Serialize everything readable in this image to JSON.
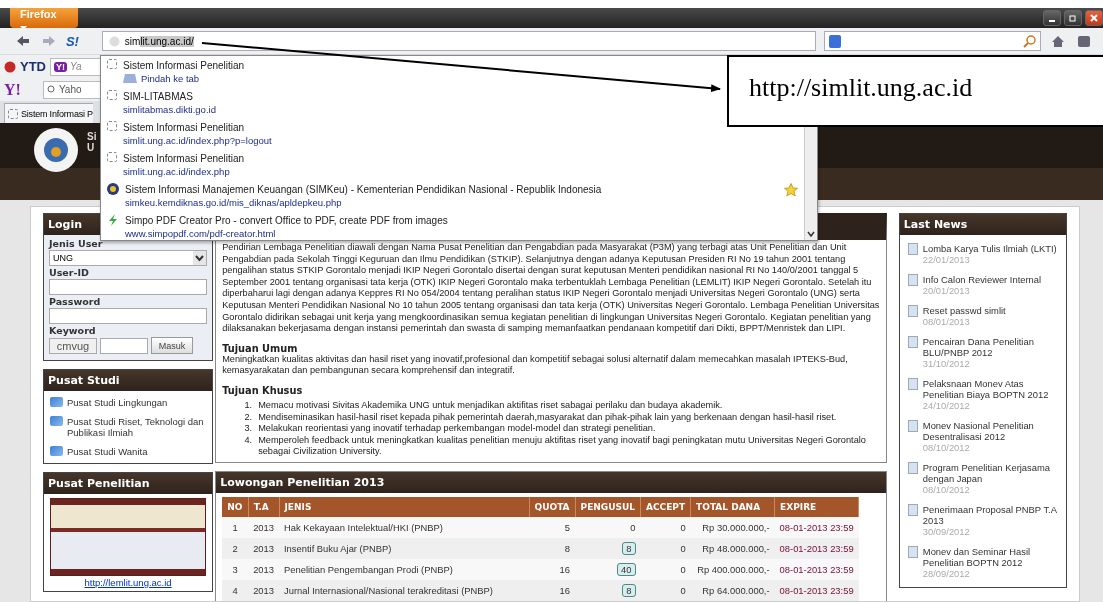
{
  "browser": {
    "menu_button": "Firefox",
    "site_logo": "S!",
    "url": {
      "typed": "sim",
      "completed": "lit.ung.ac.id/"
    }
  },
  "toolbar_ytd": {
    "brand": "YTD",
    "yahoo_badge": "Y!",
    "search_placeholder": "Ya"
  },
  "toolbar_yahoo": {
    "logo": "Y!",
    "search_placeholder": "Yaho"
  },
  "tab": {
    "title": "Sistem Informasi P"
  },
  "site_header": {
    "line_1": "Si",
    "line_2": "U"
  },
  "url_suggestions": [
    {
      "title": "Sistem Informasi Penelitian",
      "subtitle": "Pindah ke tab",
      "kind": "open-tab",
      "bookmarked": false
    },
    {
      "title": "SIM-LITABMAS",
      "subtitle": "simlitabmas.dikti.go.id",
      "kind": "page",
      "bookmarked": false
    },
    {
      "title": "Sistem Informasi Penelitian",
      "subtitle": "simlit.ung.ac.id/index.php?p=logout",
      "kind": "page",
      "bookmarked": false
    },
    {
      "title": "Sistem Informasi Penelitian",
      "subtitle": "simlit.ung.ac.id/index.php",
      "kind": "page",
      "bookmarked": false
    },
    {
      "title": "Sistem Informasi Manajemen Keuangan (SIMKeu) - Kementerian Pendidikan Nasional - Republik Indonesia",
      "subtitle": "simkeu.kemdiknas.go.id/mis_diknas/apldepkeu.php",
      "kind": "seal",
      "bookmarked": true
    },
    {
      "title": "Simpo PDF Creator Pro - convert Office to PDF, create PDF from images",
      "subtitle": "www.simpopdf.com/pdf-creator.html",
      "kind": "bolt",
      "bookmarked": false
    }
  ],
  "callout": {
    "text": "http://simlit.ung.ac.id"
  },
  "login": {
    "title": "Login",
    "user_type_label": "Jenis User",
    "user_type_value": "UNG",
    "user_id_label": "User-ID",
    "password_label": "Password",
    "keyword_label": "Keyword",
    "captcha": "cmvug",
    "submit": "Masuk"
  },
  "pusat_studi": {
    "title": "Pusat Studi",
    "items": [
      "Pusat Studi Lingkungan",
      "Pusat Studi Riset, Teknologi dan Publikasi Ilmiah",
      "Pusat Studi Wanita"
    ]
  },
  "pusat_penelitian": {
    "title": "Pusat Penelitian",
    "link": "http://lemlit.ung.ac.id"
  },
  "about": {
    "paragraph": "Pendirian Lembaga Penelitian diawali dengan Nama Pusat Penelitian dan Pengabdian pada Masyarakat (P3M) yang terbagi atas Unit Penelitian dan Unit Pengabdian pada Sekolah Tinggi Keguruan dan Ilmu Pendidikan (STKIP). Selanjutnya dengan adanya Keputusan Presiden RI No 19 tahun 2001 tentang pengalihan status STKIP Gorontalo menjadi IKIP Negeri Gorontalo disertai dengan surat keputusan Menteri pendidikan nasional RI No 140/0/2001 tanggal 5 September 2001 tentang organisasi tata kerja (OTK) IKIP Negeri Gorontalo maka terbentuklah Lembaga Penelitian (LEMLIT) IKIP Negeri Gorontalo. Setelah itu diperbaharui lagi dengan adanya Keppres RI No 054/2004 tentang peralihan status IKIP Negeri Gorontalo menjadi Universitas Negeri Gorontalo (UNG) serta Keputusan Menteri Pendidikan Nasional No 10 tahun 2005 tentang organisasi dan tata kerja (OTK) Universitas Negeri Gorontalo. Lembaga Penelitian Universitas Gorontalo didirikan sebagai unit kerja yang mengkoordinasikan semua kegiatan penelitian di lingkungan Universitas Negeri Gorontalo. Kegiatan penelitian yang dilaksanakan bekerjasama dengan instansi pemerintah dan swasta di samping memanfaatkan pendanaan kompetitif dari Dikti, BPPT/Menristek dan LIPI.",
    "general_heading": "Tujuan Umum",
    "general_text": "Meningkatkan kualitas aktivitas dan hasil riset yang inovatif,profesional dan kompetitif sebagai solusi alternatif dalam memecahkan masalah IPTEKS-Bud, kemasyarakatan dan pembangunan secara komprehensif dan integratif.",
    "specific_heading": "Tujuan Khusus",
    "specific_items": [
      {
        "number": "1.",
        "text": "Memacu motivasi Sivitas Akademika UNG untuk menjadikan aktifitas riset sabagai perilaku dan budaya akademik."
      },
      {
        "number": "2.",
        "text": "Mendiseminasikan hasil-hasil riset kepada pihak pemerintah daerah,masyarakat dan pihak-pihak lain yang berkenaan dengan hasil-hasil riset."
      },
      {
        "number": "3.",
        "text": "Melakukan reorientasi yang inovatif terhadap perkembangan model-model dan strategi penelitian."
      },
      {
        "number": "4.",
        "text": "Memperoleh feedback untuk meningkatkan kualitas penelitian menuju aktifitas riset yang inovatif bagi peningkatan mutu Universitas Negeri Gorontalo sebagai Civilization University."
      }
    ]
  },
  "lowongan": {
    "title": "Lowongan Penelitian 2013",
    "columns": [
      "NO",
      "T.A",
      "JENIS",
      "QUOTA",
      "PENGUSUL",
      "ACCEPT",
      "TOTAL DANA",
      "EXPIRE"
    ],
    "rows": [
      {
        "no": "1",
        "ta": "2013",
        "jenis": "Hak Kekayaan Intelektual/HKI (PNBP)",
        "quota": "5",
        "pengusul": {
          "value": "0",
          "kind": "plain"
        },
        "accept": "0",
        "total_dana": "Rp 30.000.000,-",
        "expire": "08-01-2013 23:59"
      },
      {
        "no": "2",
        "ta": "2013",
        "jenis": "Insentif Buku Ajar (PNBP)",
        "quota": "8",
        "pengusul": {
          "value": "8",
          "kind": "badge"
        },
        "accept": "0",
        "total_dana": "Rp 48.000.000,-",
        "expire": "08-01-2013 23:59"
      },
      {
        "no": "3",
        "ta": "2013",
        "jenis": "Penelitian Pengembangan Prodi (PNBP)",
        "quota": "16",
        "pengusul": {
          "value": "40",
          "kind": "badge"
        },
        "accept": "0",
        "total_dana": "Rp 400.000.000,-",
        "expire": "08-01-2013 23:59"
      },
      {
        "no": "4",
        "ta": "2013",
        "jenis": "Jurnal Internasional/Nasional terakreditasi (PNBP)",
        "quota": "16",
        "pengusul": {
          "value": "8",
          "kind": "badge"
        },
        "accept": "0",
        "total_dana": "Rp 64.000.000,-",
        "expire": "08-01-2013 23:59"
      }
    ]
  },
  "last_news": {
    "title": "Last News",
    "items": [
      {
        "title": "Lomba Karya Tulis Ilmiah (LKTI)",
        "date": "22/01/2013"
      },
      {
        "title": "Info Calon Reviewer Internal",
        "date": "20/01/2013"
      },
      {
        "title": "Reset passwd simlit",
        "date": "08/01/2013"
      },
      {
        "title": "Pencairan Dana Penelitian BLU/PNBP 2012",
        "date": "31/10/2012"
      },
      {
        "title": "Pelaksnaan Monev Atas Penelitian Biaya BOPTN 2012",
        "date": "24/10/2012"
      },
      {
        "title": "Monev Nasional Penelitian Desentralisasi 2012",
        "date": "08/10/2012"
      },
      {
        "title": "Program Penelitian Kerjasama dengan Japan",
        "date": "08/10/2012"
      },
      {
        "title": "Penerimaan Proposal PNBP T.A 2013",
        "date": "30/09/2012"
      },
      {
        "title": "Monev dan Seminar Hasil Penelitian BOPTN 2012",
        "date": "28/09/2012"
      }
    ]
  }
}
